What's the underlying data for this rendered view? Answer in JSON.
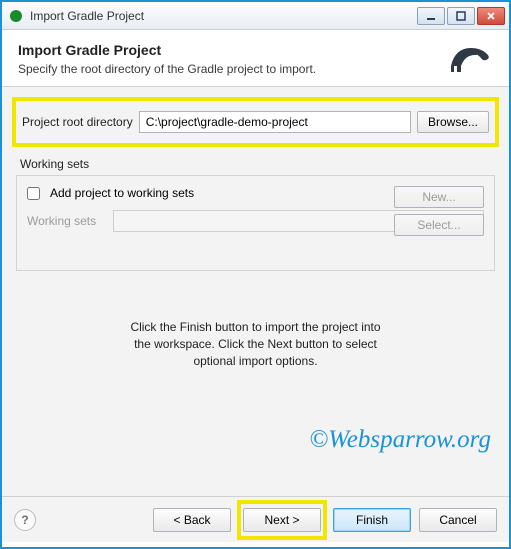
{
  "window": {
    "title": "Import Gradle Project"
  },
  "header": {
    "title": "Import Gradle Project",
    "subtitle": "Specify the root directory of the Gradle project to import."
  },
  "form": {
    "rootDirLabel": "Project root directory",
    "rootDirValue": "C:\\project\\gradle-demo-project",
    "browseLabel": "Browse..."
  },
  "workingSets": {
    "sectionLabel": "Working sets",
    "checkboxLabel": "Add project to working sets",
    "checkboxChecked": false,
    "comboLabel": "Working sets",
    "newLabel": "New...",
    "selectLabel": "Select..."
  },
  "hint": {
    "line1": "Click the Finish button to import the project into",
    "line2": "the workspace. Click the Next button to select",
    "line3": "optional import options."
  },
  "watermark": "©Websparrow.org",
  "buttons": {
    "back": "< Back",
    "next": "Next >",
    "finish": "Finish",
    "cancel": "Cancel"
  }
}
